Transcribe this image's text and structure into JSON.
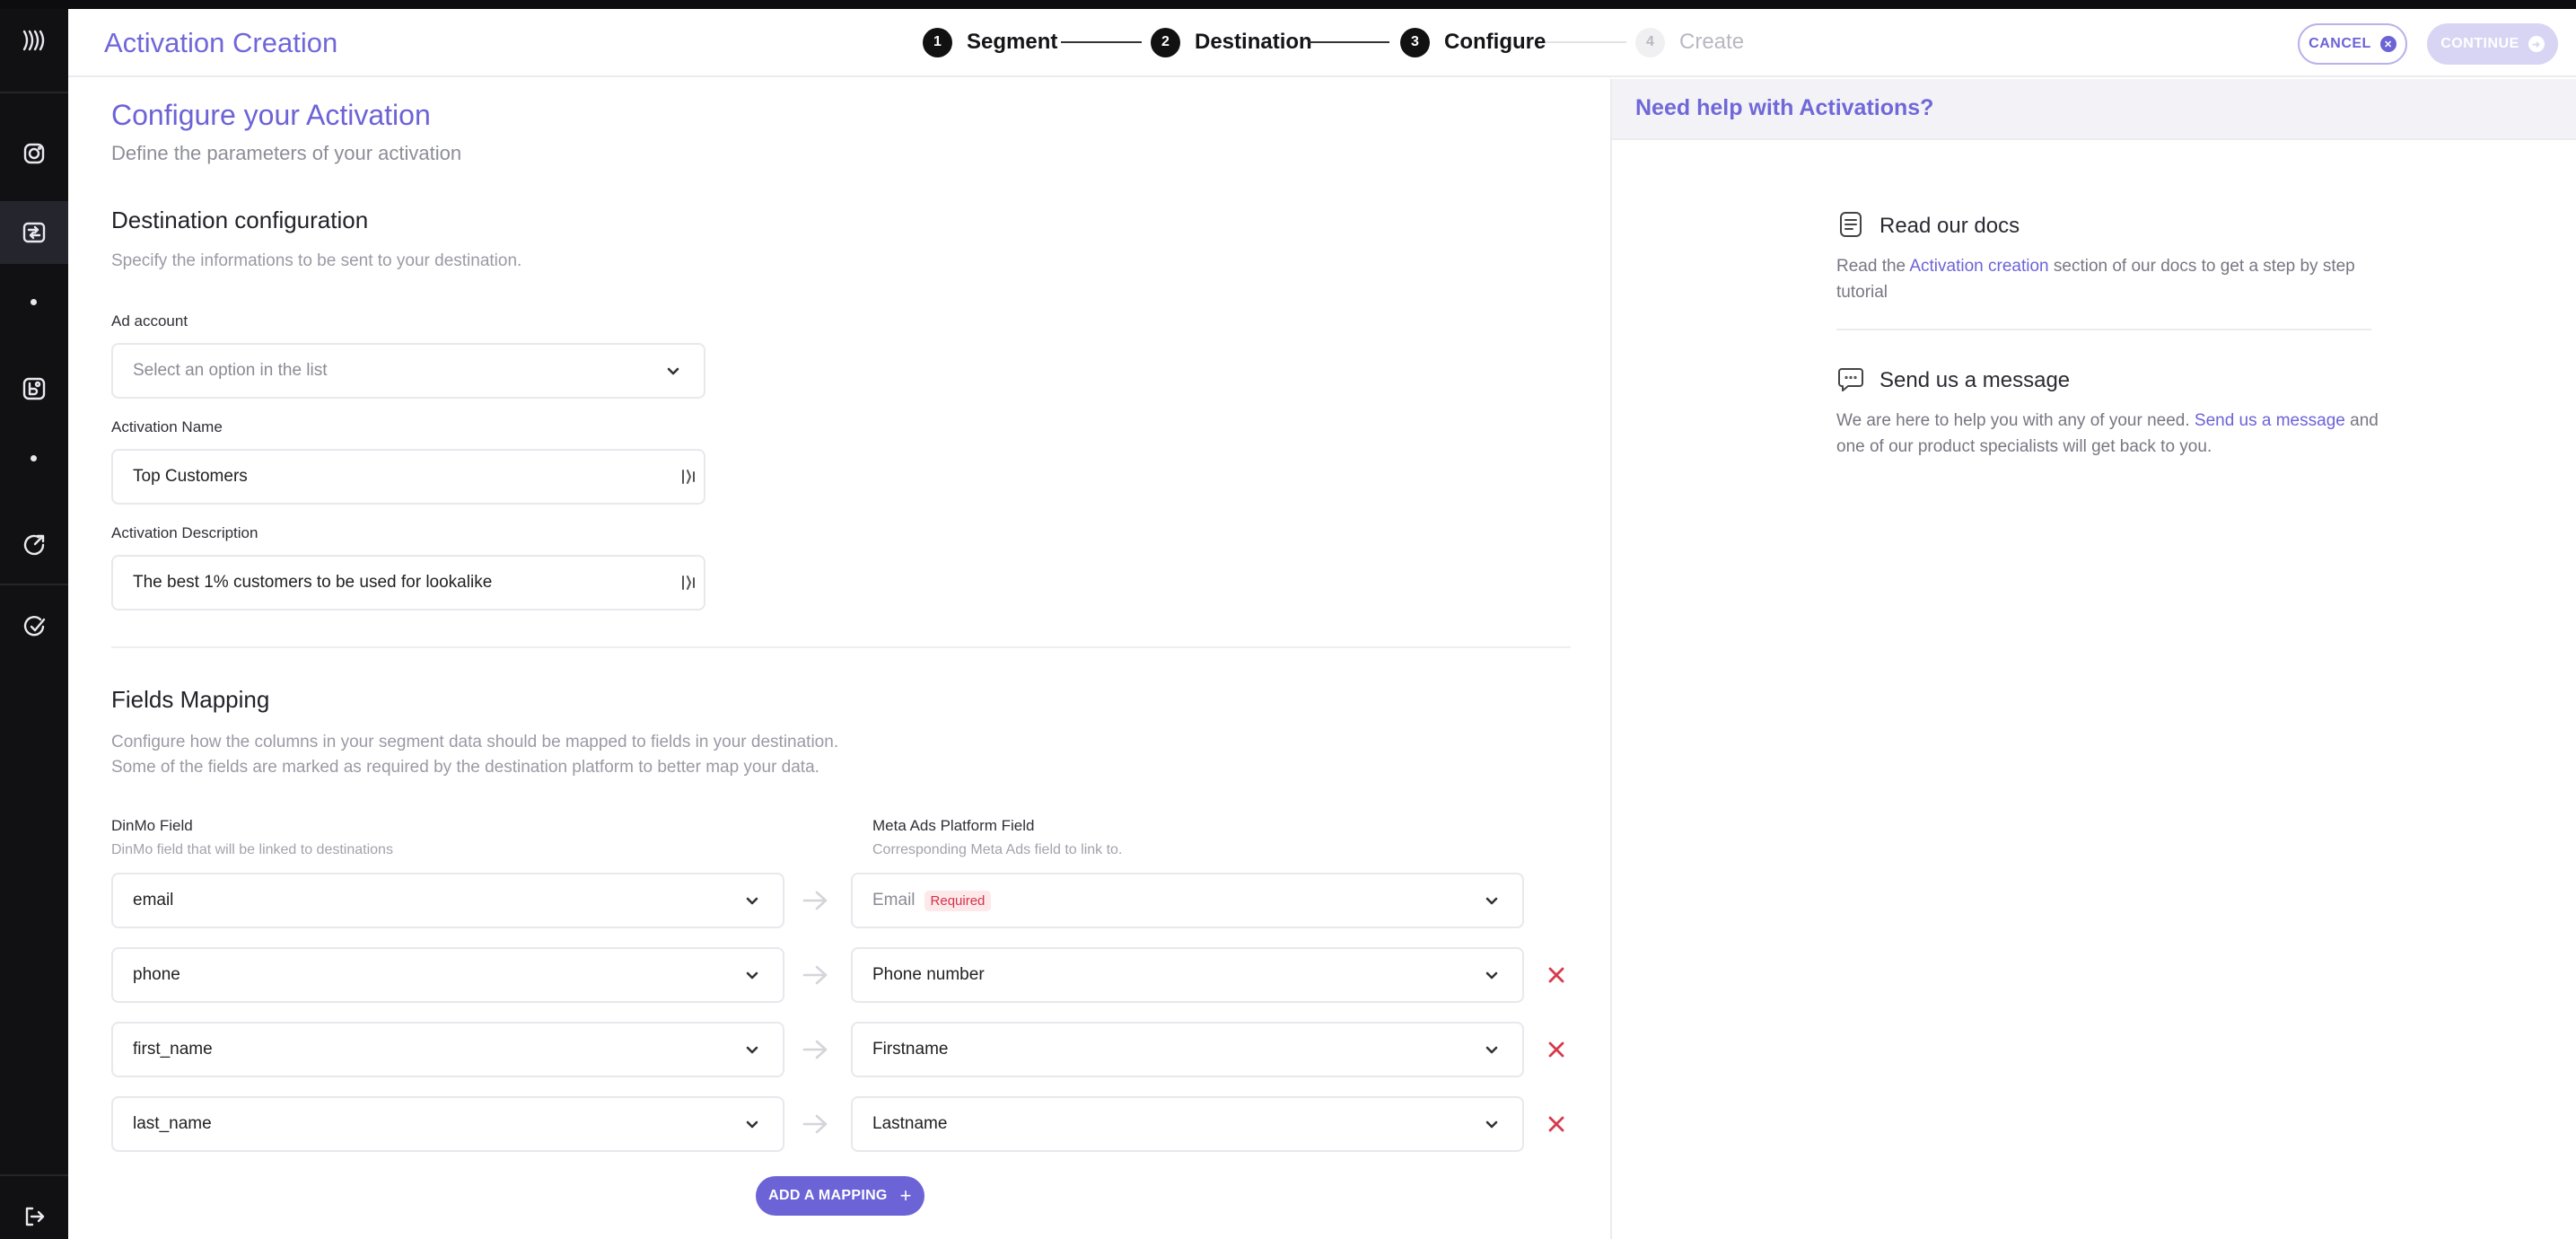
{
  "header": {
    "title": "Activation Creation",
    "steps": [
      {
        "num": "1",
        "label": "Segment",
        "state": "done"
      },
      {
        "num": "2",
        "label": "Destination",
        "state": "done"
      },
      {
        "num": "3",
        "label": "Configure",
        "state": "current"
      },
      {
        "num": "4",
        "label": "Create",
        "state": "upcoming"
      }
    ],
    "cancel_label": "CANCEL",
    "continue_label": "CONTINUE"
  },
  "sidebar": {
    "icons": [
      "logo-icon",
      "instagram-icon",
      "activations-icon",
      "segments-icon",
      "refresh-icon",
      "analytics-icon",
      "logout-icon"
    ]
  },
  "page": {
    "title": "Configure your Activation",
    "subtitle": "Define the parameters of your activation"
  },
  "destination_config": {
    "title": "Destination configuration",
    "description": "Specify the informations to be sent to your destination.",
    "ad_account": {
      "label": "Ad account",
      "placeholder": "Select an option in the list"
    },
    "activation_name": {
      "label": "Activation Name",
      "value": "Top Customers"
    },
    "activation_description": {
      "label": "Activation Description",
      "value": "The best 1% customers to be used for lookalike"
    }
  },
  "fields_mapping": {
    "title": "Fields Mapping",
    "description_line1": "Configure how the columns in your segment data should be mapped to fields in your destination.",
    "description_line2": "Some of the fields are marked as required by the destination platform to better map your data.",
    "left_header": "DinMo Field",
    "left_sub": "DinMo field that will be linked to destinations",
    "right_header": "Meta Ads Platform Field",
    "right_sub": "Corresponding Meta Ads field to link to.",
    "rows": [
      {
        "dinmo": "email",
        "meta": "Email",
        "badge": "Required"
      },
      {
        "dinmo": "phone",
        "meta": "Phone number"
      },
      {
        "dinmo": "first_name",
        "meta": "Firstname"
      },
      {
        "dinmo": "last_name",
        "meta": "Lastname"
      }
    ],
    "add_label": "ADD A MAPPING"
  },
  "help": {
    "title": "Need help with Activations?",
    "docs_title": "Read our docs",
    "docs_text_before": "Read the ",
    "docs_link": "Activation creation",
    "docs_text_after": " section of our docs to get a step by step tutorial",
    "message_title": "Send us a message",
    "message_text_before": "We are here to help you with any of your need. ",
    "message_link": "Send us a message",
    "message_text_after": " and one of our product specialists will get back to you."
  },
  "colors": {
    "accent": "#6c63d6",
    "sidebar_bg": "#111114",
    "required_red": "#d4334a"
  }
}
